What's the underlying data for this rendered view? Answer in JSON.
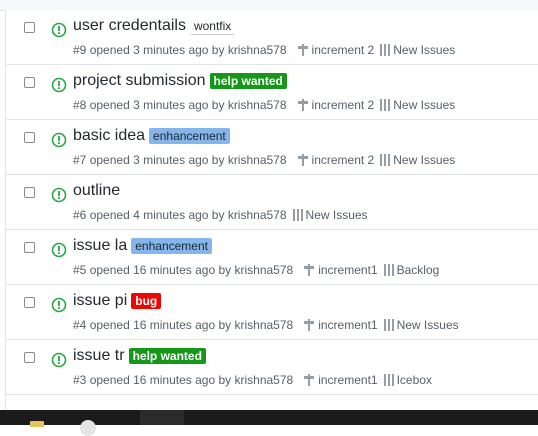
{
  "issues": [
    {
      "title": "user credentails",
      "label": "wontfix",
      "label_kind": "wontfix",
      "number": "#9",
      "opened": "opened 3 minutes ago by",
      "author": "krishna578",
      "milestone": "increment 2",
      "project": "New Issues"
    },
    {
      "title": "project submission",
      "label": "help wanted",
      "label_kind": "help",
      "number": "#8",
      "opened": "opened 3 minutes ago by",
      "author": "krishna578",
      "milestone": "increment 2",
      "project": "New Issues"
    },
    {
      "title": "basic idea",
      "label": "enhancement",
      "label_kind": "enh",
      "number": "#7",
      "opened": "opened 3 minutes ago by",
      "author": "krishna578",
      "milestone": "increment 2",
      "project": "New Issues"
    },
    {
      "title": "outline",
      "label": "",
      "label_kind": "",
      "number": "#6",
      "opened": "opened 4 minutes ago by",
      "author": "krishna578",
      "milestone": "",
      "project": "New Issues"
    },
    {
      "title": "issue la",
      "label": "enhancement",
      "label_kind": "enh",
      "number": "#5",
      "opened": "opened 16 minutes ago by",
      "author": "krishna578",
      "milestone": "increment1",
      "project": "Backlog"
    },
    {
      "title": "issue pi",
      "label": "bug",
      "label_kind": "bug",
      "number": "#4",
      "opened": "opened 16 minutes ago by",
      "author": "krishna578",
      "milestone": "increment1",
      "project": "New Issues"
    },
    {
      "title": "issue tr",
      "label": "help wanted",
      "label_kind": "help",
      "number": "#3",
      "opened": "opened 16 minutes ago by",
      "author": "krishna578",
      "milestone": "increment1",
      "project": "Icebox"
    }
  ],
  "colors": {
    "open_issue_icon": "#28a745",
    "label_help_wanted": "#159818",
    "label_enhancement": "#84b6eb",
    "label_bug": "#ee0701"
  },
  "icons": {
    "issue": "issue-opened-icon",
    "milestone": "milestone-icon",
    "project": "project-icon"
  }
}
